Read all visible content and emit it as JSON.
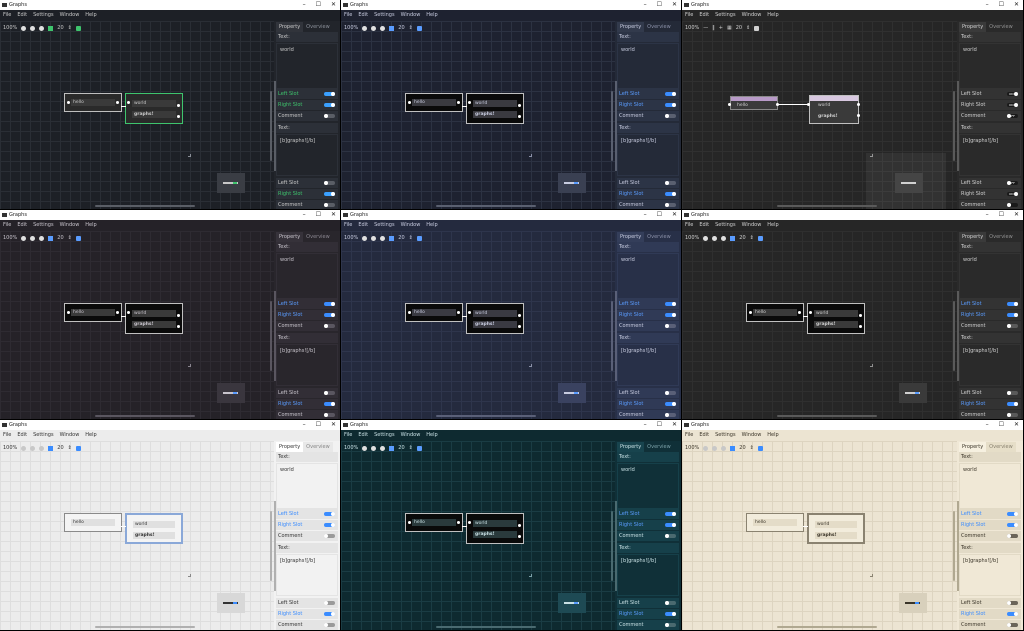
{
  "windows": [
    {
      "title": "Graphs",
      "theme": {
        "bg": "#1d2026",
        "grid": "#2a2e35",
        "panel": "#22252b",
        "panelAlt": "#2c3038",
        "text": "#c8c8c8",
        "muted": "#8a8f98",
        "accent": "#3ec46d",
        "toggleOn": "#3aa0ff",
        "toggleOff": "#5a5e66",
        "node": "#2a2a2a",
        "nodeBorder": "#bfbfbf",
        "nodeSel": "#3ec46d",
        "field": "#3a3a3a",
        "port": "#ffffff",
        "tab": "#31343b",
        "tabInactive": "#22252b",
        "menuBg": "#1d2026",
        "minimap": "#3a3d44",
        "scroll": "#5a5e66"
      },
      "toolbarStyle": "normal",
      "nodeStyle": "dark"
    },
    {
      "title": "Graphs",
      "theme": {
        "bg": "#1e2230",
        "grid": "#2c3242",
        "panel": "#242a38",
        "panelAlt": "#2c3446",
        "text": "#c8cce0",
        "muted": "#8a90a8",
        "accent": "#5a9cff",
        "toggleOn": "#3a8cff",
        "toggleOff": "#5a6070",
        "node": "#0a0a0a",
        "nodeBorder": "#c0c0c0",
        "nodeSel": "#c0c0c0",
        "field": "#3a3a40",
        "port": "#ffffff",
        "tab": "#323a4c",
        "tabInactive": "#242a38",
        "menuBg": "#1e2230",
        "minimap": "#3a4052",
        "scroll": "#5a6070"
      },
      "toolbarStyle": "normal",
      "nodeStyle": "dark"
    },
    {
      "title": "Graphs",
      "theme": {
        "bg": "#262626",
        "grid": "#303030",
        "panel": "#2a2a2a",
        "panelAlt": "#333333",
        "text": "#d0d0d0",
        "muted": "#909090",
        "accent": "#d0d0d0",
        "toggleOn": "#1a1a1a",
        "toggleOff": "#1a1a1a",
        "node": "#3a3a3a",
        "nodeBorder": "#c0c0c0",
        "nodeSel": "#ffffff",
        "field": "#2a2a2a",
        "port": "#ffffff",
        "tab": "#3a3a3a",
        "tabInactive": "#2a2a2a",
        "menuBg": "#262626",
        "minimap": "#3a3a3a",
        "scroll": "#5a5a5a"
      },
      "toolbarStyle": "flat",
      "nodeStyle": "purple"
    },
    {
      "title": "Graphs",
      "theme": {
        "bg": "#252228",
        "grid": "#2e2b32",
        "panel": "#29262c",
        "panelAlt": "#322e36",
        "text": "#c8c4cc",
        "muted": "#8a8690",
        "accent": "#5a9cff",
        "toggleOn": "#3a8cff",
        "toggleOff": "#5a5660",
        "node": "#0a0a0a",
        "nodeBorder": "#c0c0c0",
        "nodeSel": "#c0c0c0",
        "field": "#3a3a3a",
        "port": "#ffffff",
        "tab": "#36323a",
        "tabInactive": "#29262c",
        "menuBg": "#252228",
        "minimap": "#3a363e",
        "scroll": "#5a5660"
      },
      "toolbarStyle": "normal",
      "nodeStyle": "dark"
    },
    {
      "title": "Graphs",
      "theme": {
        "bg": "#242a3e",
        "grid": "#2e354c",
        "panel": "#283048",
        "panelAlt": "#303a56",
        "text": "#c8cce0",
        "muted": "#8a90a8",
        "accent": "#5a9cff",
        "toggleOn": "#3a8cff",
        "toggleOff": "#5a6078",
        "node": "#0a0a0a",
        "nodeBorder": "#c0c0c0",
        "nodeSel": "#c0c0c0",
        "field": "#3a3a42",
        "port": "#ffffff",
        "tab": "#343e5a",
        "tabInactive": "#283048",
        "menuBg": "#242a3e",
        "minimap": "#3a4260",
        "scroll": "#5a6078"
      },
      "toolbarStyle": "normal",
      "nodeStyle": "dark"
    },
    {
      "title": "Graphs",
      "theme": {
        "bg": "#262626",
        "grid": "#2f2f2f",
        "panel": "#2a2a2a",
        "panelAlt": "#333333",
        "text": "#d0d0d0",
        "muted": "#909090",
        "accent": "#5a9cff",
        "toggleOn": "#3a8cff",
        "toggleOff": "#5a5a5a",
        "node": "#0a0a0a",
        "nodeBorder": "#c0c0c0",
        "nodeSel": "#c0c0c0",
        "field": "#3a3a3a",
        "port": "#ffffff",
        "tab": "#3a3a3a",
        "tabInactive": "#2a2a2a",
        "menuBg": "#262626",
        "minimap": "#3a3a3a",
        "scroll": "#5a5a5a"
      },
      "toolbarStyle": "normal",
      "nodeStyle": "dark"
    },
    {
      "title": "Graphs",
      "theme": {
        "bg": "#ececec",
        "grid": "#dedede",
        "panel": "#f2f2f2",
        "panelAlt": "#e4e4e4",
        "text": "#333333",
        "muted": "#888888",
        "accent": "#3a8cff",
        "toggleOn": "#3a8cff",
        "toggleOff": "#9a9a9a",
        "node": "#f4f4f4",
        "nodeBorder": "#8a8a8a",
        "nodeSel": "#8aa8d8",
        "field": "#e0e0e0",
        "port": "#ffffff",
        "tab": "#ffffff",
        "tabInactive": "#e8e8e8",
        "menuBg": "#ececec",
        "minimap": "#d8d8d8",
        "scroll": "#b0b0b0"
      },
      "toolbarStyle": "light",
      "nodeStyle": "light"
    },
    {
      "title": "Graphs",
      "theme": {
        "bg": "#0e2a30",
        "grid": "#1a3c44",
        "panel": "#103038",
        "panelAlt": "#16404a",
        "text": "#c8e0e4",
        "muted": "#7aa0a8",
        "accent": "#5a9cff",
        "toggleOn": "#3a8cff",
        "toggleOff": "#4a6a70",
        "node": "#0a0a0a",
        "nodeBorder": "#c0c0c0",
        "nodeSel": "#c0c0c0",
        "field": "#2a3a3c",
        "port": "#ffffff",
        "tab": "#18444e",
        "tabInactive": "#103038",
        "menuBg": "#0e2a30",
        "minimap": "#1e4a54",
        "scroll": "#4a6a70"
      },
      "toolbarStyle": "normal",
      "nodeStyle": "dark"
    },
    {
      "title": "Graphs",
      "theme": {
        "bg": "#ece4d2",
        "grid": "#ddd4c0",
        "panel": "#f0e8d6",
        "panelAlt": "#e2dac6",
        "text": "#3a3428",
        "muted": "#8a8270",
        "accent": "#3a8cff",
        "toggleOn": "#3a8cff",
        "toggleOff": "#6a6458",
        "node": "#f2ecdc",
        "nodeBorder": "#8a8270",
        "nodeSel": "#8a8270",
        "field": "#e4dcc8",
        "port": "#ffffff",
        "tab": "#f6f0e0",
        "tabInactive": "#e6dec8",
        "menuBg": "#ece4d2",
        "minimap": "#d8d0bc",
        "scroll": "#b0a890"
      },
      "toolbarStyle": "light",
      "nodeStyle": "light"
    }
  ],
  "menu": [
    "File",
    "Edit",
    "Settings",
    "Window",
    "Help"
  ],
  "toolbar": {
    "zoom": "100%",
    "count": "20"
  },
  "node1": {
    "text": "hello"
  },
  "node2": {
    "line1": "world",
    "line2": "graphs!"
  },
  "panel": {
    "tab_property": "Property",
    "tab_overview": "Overview",
    "text_label": "Text:",
    "text_value": "world",
    "left_slot": "Left Slot",
    "right_slot": "Right Slot",
    "comment": "Comment",
    "text_label2": "Text:",
    "text_value2": "[b]graphs![/b]",
    "left_slot2": "Left Slot",
    "right_slot2": "Right Slot",
    "comment2": "Comment"
  },
  "icons": {
    "minimize": "minimize-icon",
    "maximize": "maximize-icon",
    "close": "close-icon"
  }
}
